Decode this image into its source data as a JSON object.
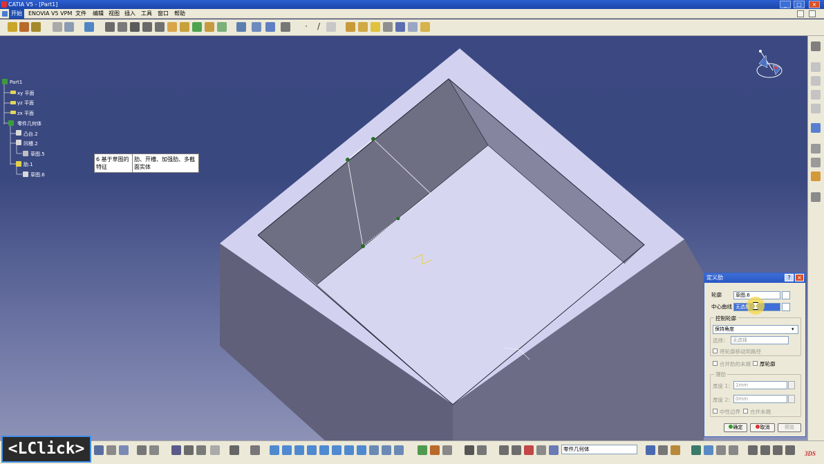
{
  "window": {
    "title": "CATIA V5 - [Part1]",
    "buttons": [
      "_",
      "□",
      "×"
    ]
  },
  "menu": [
    "开始",
    "ENOVIA V5 VPM",
    "文件",
    "编辑",
    "视图",
    "插入",
    "工具",
    "窗口",
    "帮助"
  ],
  "tree": {
    "root": "Part1",
    "items": [
      "xy 平面",
      "yz 平面",
      "zx 平面",
      "零件几何体",
      "凸台.2",
      "凹槽.2",
      "草图.5",
      "肋.1",
      "草图.6"
    ]
  },
  "tooltip": {
    "col1": "6 基于草图的特征",
    "col2": "肋、开槽、加强肋、多截面实体"
  },
  "dialog": {
    "title": "定义肋",
    "title_buttons": [
      "?",
      "×"
    ],
    "profile_label": "轮廓",
    "profile_value": "草图.6",
    "center_curve_label": "中心曲线",
    "center_curve_value": "无选择",
    "control_group_label": "控制轮廓",
    "control_option": "保持角度",
    "selection_label": "选择：",
    "selection_value": "无选择",
    "project_checkbox": "将轮廓移动到路径",
    "merge_ends_checkbox": "合并肋的末端",
    "thick_profile_checkbox": "厚轮廓",
    "thin_group_label": "薄肋",
    "thickness1_label": "厚度 1：",
    "thickness1_value": "1mm",
    "thickness2_label": "厚度 2：",
    "thickness2_value": "0mm",
    "neutral_fiber_checkbox": "中性边界",
    "merge_ends2_checkbox": "合并末端",
    "ok_label": "确定",
    "cancel_label": "取消",
    "preview_label": "预览"
  },
  "status_combo": "零件几何体",
  "overlay": {
    "click_indicator": "<LClick>"
  },
  "colors": {
    "viewport_top": "#3b4881",
    "part_face": "#d2d2f0",
    "inner_wall_dark": "#6f6f84",
    "inner_wall_mid": "#8585a0",
    "highlight": "#f5d845"
  }
}
